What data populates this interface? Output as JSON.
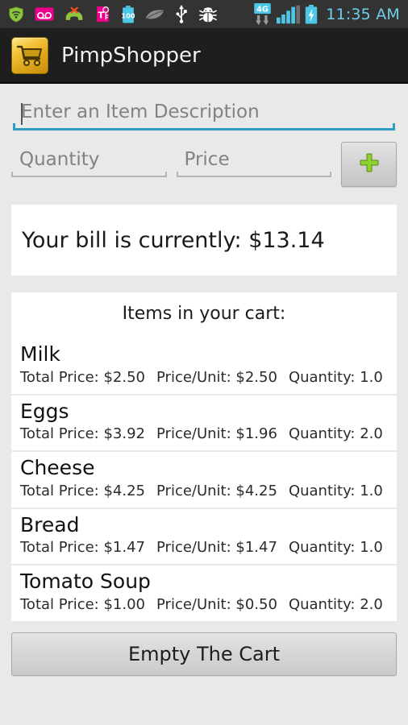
{
  "status_bar": {
    "icons": [
      {
        "name": "wifi-shield-icon",
        "color": "#8cc63f"
      },
      {
        "name": "voicemail-icon",
        "color": "#ec008c"
      },
      {
        "name": "missed-call-icon",
        "color": "#8cc63f"
      },
      {
        "name": "tmobile-tag-icon",
        "color": "#ec008c"
      },
      {
        "name": "battery-100-icon",
        "color": "#4cc7e8"
      },
      {
        "name": "leaf-icon",
        "color": "#8a8a8a"
      },
      {
        "name": "usb-icon",
        "color": "#ffffff"
      },
      {
        "name": "android-bug-icon",
        "color": "#ffffff"
      }
    ],
    "network_label": "4G",
    "signal_bars": 4,
    "time": "11:35 AM",
    "background_color": "#333333",
    "time_color": "#6fd0e8"
  },
  "title_bar": {
    "app_name": "PimpShopper",
    "icon_name": "shopping-cart-icon",
    "background_color": "#1e1e1e"
  },
  "form": {
    "description": {
      "value": "",
      "placeholder": "Enter an Item Description",
      "focused": true,
      "underline_color": "#2f9dc0"
    },
    "quantity": {
      "value": "",
      "placeholder": "Quantity"
    },
    "price": {
      "value": "",
      "placeholder": "Price"
    },
    "add_button": {
      "icon_name": "plus-icon",
      "color": "#7cb928",
      "label": "+"
    }
  },
  "bill": {
    "text": "Your bill is currently: $13.14",
    "amount": "$13.14"
  },
  "cart": {
    "header": "Items in your cart:",
    "labels": {
      "total_price": "Total Price:",
      "price_per_unit": "Price/Unit:",
      "quantity": "Quantity:"
    },
    "items": [
      {
        "name": "Milk",
        "total_price": "Total Price: $2.50",
        "price_per_unit": "Price/Unit: $2.50",
        "quantity": "Quantity: 1.0"
      },
      {
        "name": "Eggs",
        "total_price": "Total Price: $3.92",
        "price_per_unit": "Price/Unit: $1.96",
        "quantity": "Quantity: 2.0"
      },
      {
        "name": "Cheese",
        "total_price": "Total Price: $4.25",
        "price_per_unit": "Price/Unit: $4.25",
        "quantity": "Quantity: 1.0"
      },
      {
        "name": "Bread",
        "total_price": "Total Price: $1.47",
        "price_per_unit": "Price/Unit: $1.47",
        "quantity": "Quantity: 1.0"
      },
      {
        "name": "Tomato Soup",
        "total_price": "Total Price: $1.00",
        "price_per_unit": "Price/Unit: $0.50",
        "quantity": "Quantity: 2.0"
      }
    ]
  },
  "footer": {
    "empty_cart_label": "Empty The Cart"
  }
}
